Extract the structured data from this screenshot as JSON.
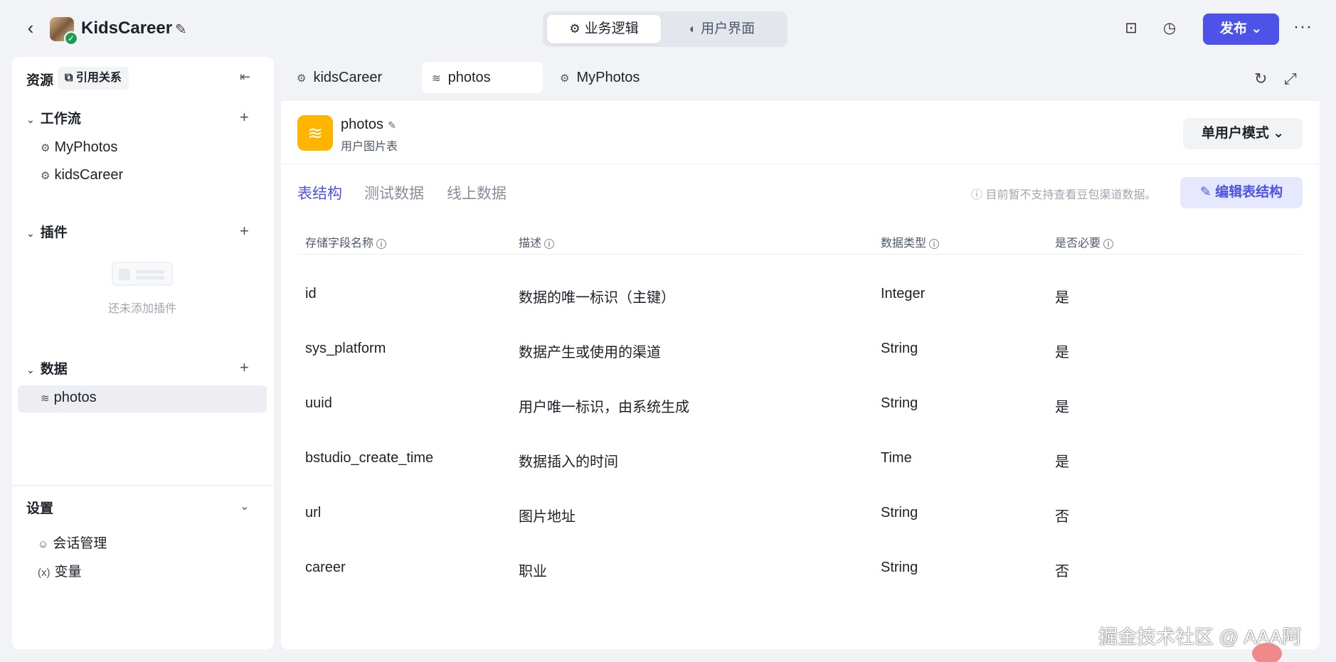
{
  "topbar": {
    "back": "‹",
    "app_title": "KidsCareer",
    "seg_items": [
      {
        "icon": "⚙",
        "label": "业务逻辑"
      },
      {
        "icon": "◐",
        "label": "用户界面"
      }
    ],
    "publish_label": "发布",
    "publish_caret": "⌄"
  },
  "sidebar": {
    "resources_label": "资源",
    "refs_label": "引用关系",
    "workflow_title": "工作流",
    "workflows": [
      "MyPhotos",
      "kidsCareer"
    ],
    "plugins_title": "插件",
    "plugins_empty": "还未添加插件",
    "data_title": "数据",
    "data_items": [
      "photos"
    ],
    "settings_title": "设置",
    "settings_items": [
      {
        "icon": "☺",
        "label": "会话管理"
      },
      {
        "icon": "(x)",
        "label": "变量"
      }
    ]
  },
  "tabs": [
    {
      "icon": "⚙",
      "label": "kidsCareer"
    },
    {
      "icon": "≋",
      "label": "photos"
    },
    {
      "icon": "⚙",
      "label": "MyPhotos"
    }
  ],
  "table_header": {
    "name": "photos",
    "desc": "用户图片表",
    "mode_label": "单用户模式"
  },
  "subtabs": [
    "表结构",
    "测试数据",
    "线上数据"
  ],
  "notice": "目前暂不支持查看豆包渠道数据。",
  "edit_struct_label": "编辑表结构",
  "columns": [
    "存储字段名称",
    "描述",
    "数据类型",
    "是否必要"
  ],
  "rows": [
    [
      "id",
      "数据的唯一标识（主键）",
      "Integer",
      "是"
    ],
    [
      "sys_platform",
      "数据产生或使用的渠道",
      "String",
      "是"
    ],
    [
      "uuid",
      "用户唯一标识，由系统生成",
      "String",
      "是"
    ],
    [
      "bstudio_create_time",
      "数据插入的时间",
      "Time",
      "是"
    ],
    [
      "url",
      "图片地址",
      "String",
      "否"
    ],
    [
      "career",
      "职业",
      "String",
      "否"
    ]
  ],
  "watermark": "掘金技术社区 @ AAA阿giao",
  "colors": {
    "accent": "#4d53e8",
    "db_badge": "#ffb400",
    "ok": "#1f9d55"
  }
}
